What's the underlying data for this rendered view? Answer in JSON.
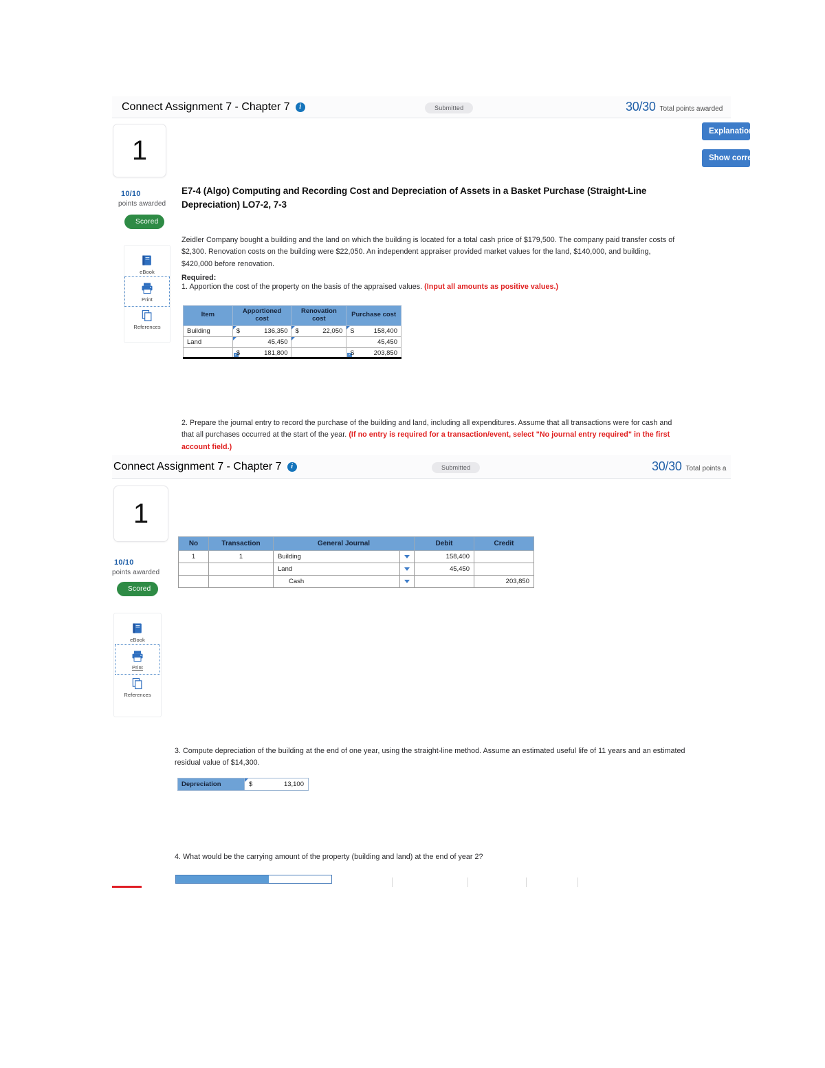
{
  "sections": [
    {
      "header": {
        "title": "Connect Assignment 7 - Chapter 7",
        "info_icon": "info-icon",
        "status": "Submitted",
        "points": "30/30",
        "points_label": "Total points awarded"
      },
      "question_number": "1",
      "actions": [
        {
          "label": "Explanation"
        },
        {
          "label": "Show correct"
        }
      ],
      "meta": {
        "points_awarded": "10/10",
        "points_sub": "points awarded",
        "badge": "Scored"
      },
      "tools": [
        {
          "label": "eBook",
          "icon": "ebook-icon"
        },
        {
          "label": "Print",
          "icon": "printer-icon"
        },
        {
          "label": "References",
          "icon": "references-icon"
        }
      ],
      "question_title": "E7-4 (Algo) Computing and Recording Cost and Depreciation of Assets in a Basket Purchase (Straight-Line Depreciation) LO7-2, 7-3",
      "scenario": "Zeidler Company bought a building and the land on which the building is located for a total cash price of $179,500. The company paid transfer costs of $2,300. Renovation costs on the building were $22,050. An independent appraiser provided market values for the land, $140,000, and building, $420,000 before renovation.",
      "required_label": "Required:",
      "req1_text": "1. Apportion the cost of the property on the basis of the appraised values. ",
      "req1_note": "(Input all amounts as positive values.)",
      "req2_text": "2. Prepare the journal entry to record the purchase of the building and land, including all expenditures. Assume that all transactions were for cash and that all purchases occurred at the start of the year. ",
      "req2_note": "(If no entry is required for a transaction/event, select \"No journal entry required\" in the first account field.)"
    },
    {
      "header": {
        "title": "Connect Assignment 7 - Chapter 7",
        "info_icon": "info-icon",
        "status": "Submitted",
        "points": "30/30",
        "points_label": "Total points a"
      },
      "question_number": "1",
      "meta": {
        "points_awarded": "10/10",
        "points_sub": "points awarded",
        "badge": "Scored"
      },
      "tools": [
        {
          "label": "eBook",
          "icon": "ebook-icon"
        },
        {
          "label": "Print",
          "icon": "printer-icon"
        },
        {
          "label": "References",
          "icon": "references-icon"
        }
      ],
      "req3_text": "3. Compute depreciation of the building at the end of one year, using the straight-line method. Assume an estimated useful life of 11 years and an estimated residual value of $14,300.",
      "req4_text": "4. What would be the carrying amount of the property (building and land) at the end of year 2?"
    }
  ],
  "apportion_table": {
    "headers": [
      "Item",
      "Apportioned cost",
      "Renovation cost",
      "Purchase cost"
    ],
    "rows": [
      {
        "item": "Building",
        "apportioned_sym": "$",
        "apportioned": "136,350",
        "renovation_sym": "$",
        "renovation": "22,050",
        "purchase_sym": "S",
        "purchase": "158,400"
      },
      {
        "item": "Land",
        "apportioned_sym": "",
        "apportioned": "45,450",
        "renovation_sym": "",
        "renovation": "",
        "purchase_sym": "",
        "purchase": "45,450"
      }
    ],
    "total": {
      "item": "",
      "apportioned_sym": "$",
      "apportioned": "181,800",
      "renovation_sym": "",
      "renovation": "",
      "purchase_sym": "S",
      "purchase": "203,850"
    }
  },
  "journal_table": {
    "headers": [
      "No",
      "Transaction",
      "General Journal",
      "Debit",
      "Credit"
    ],
    "rows": [
      {
        "no": "1",
        "transaction": "1",
        "account": "Building",
        "indent": false,
        "debit": "158,400",
        "credit": ""
      },
      {
        "no": "",
        "transaction": "",
        "account": "Land",
        "indent": false,
        "debit": "45,450",
        "credit": ""
      },
      {
        "no": "",
        "transaction": "",
        "account": "Cash",
        "indent": true,
        "debit": "",
        "credit": "203,850"
      }
    ]
  },
  "depreciation_row": {
    "label": "Depreciation",
    "symbol": "$",
    "value": "13,100"
  },
  "colors": {
    "header_blue": "#6ea2d6",
    "button_blue": "#3d7cc9",
    "score_blue": "#1f5fa8",
    "badge_green": "#2e8b45",
    "note_red": "#e02020"
  }
}
